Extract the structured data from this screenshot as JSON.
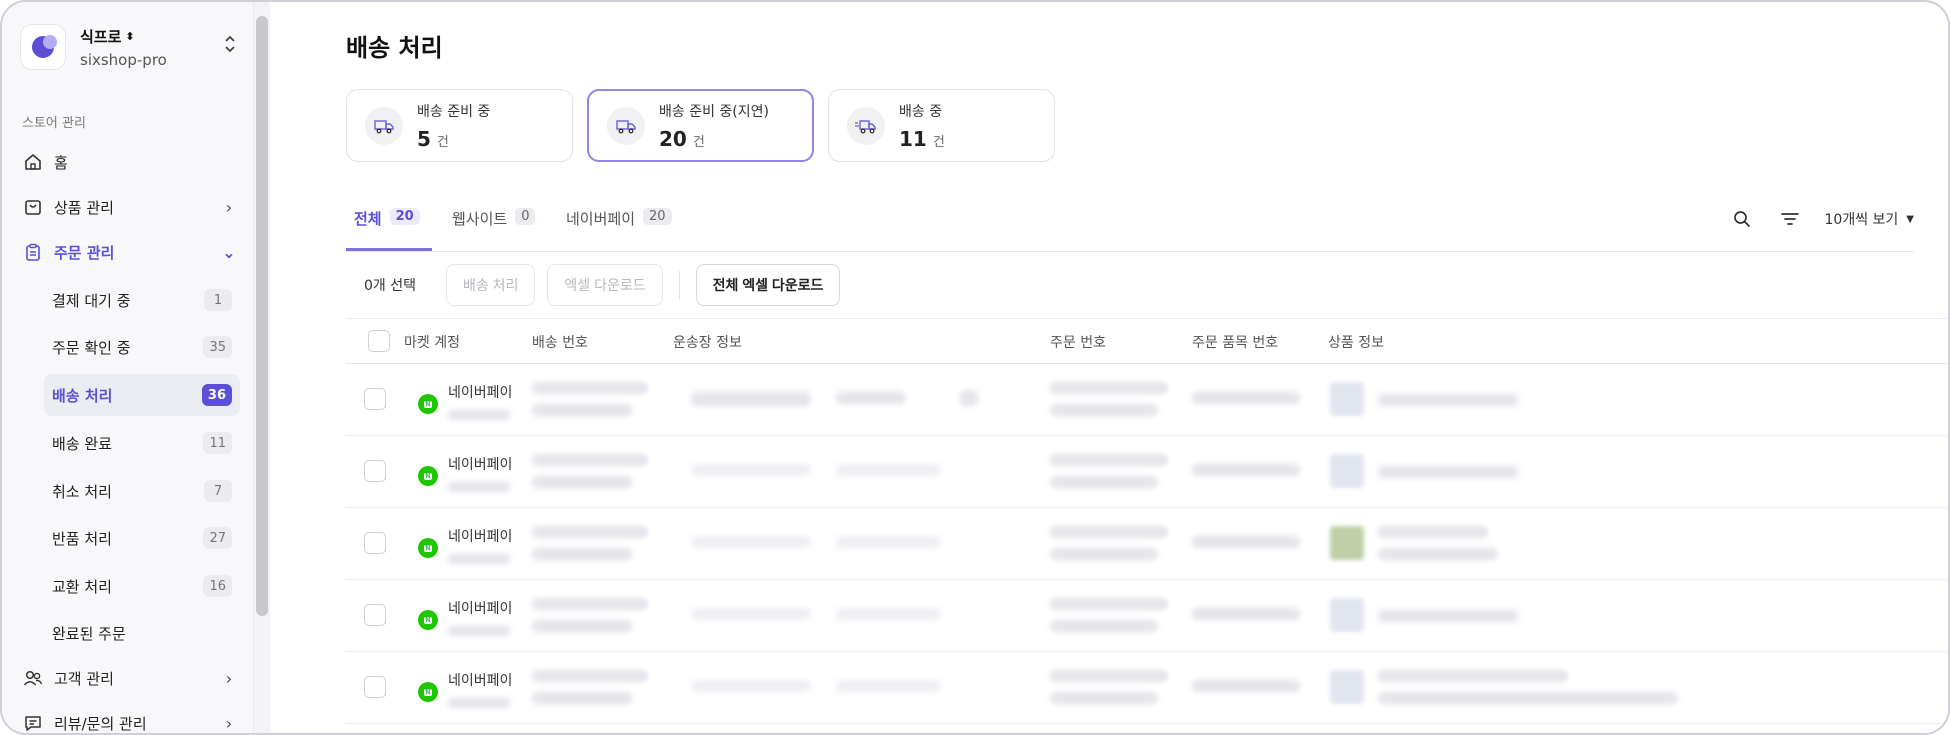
{
  "sidebar": {
    "store_name": "식프로",
    "store_sub": "sixshop-pro",
    "section_label": "스토어 관리",
    "nav": [
      {
        "label": "홈",
        "icon": "home-icon"
      },
      {
        "label": "상품 관리",
        "icon": "shopping-bag-icon"
      },
      {
        "label": "주문 관리",
        "icon": "clipboard-icon"
      }
    ],
    "order_sub": [
      {
        "label": "결제 대기 중",
        "count": "1"
      },
      {
        "label": "주문 확인 중",
        "count": "35"
      },
      {
        "label": "배송 처리",
        "count": "36"
      },
      {
        "label": "배송 완료",
        "count": "11"
      },
      {
        "label": "취소 처리",
        "count": "7"
      },
      {
        "label": "반품 처리",
        "count": "27"
      },
      {
        "label": "교환 처리",
        "count": "16"
      },
      {
        "label": "완료된 주문",
        "count": ""
      }
    ],
    "nav_bottom": [
      {
        "label": "고객 관리",
        "icon": "users-icon"
      },
      {
        "label": "리뷰/문의 관리",
        "icon": "chat-icon"
      }
    ]
  },
  "page": {
    "title": "배송 처리",
    "stats": [
      {
        "label": "배송 준비 중",
        "value": "5",
        "unit": "건"
      },
      {
        "label": "배송 준비 중(지연)",
        "value": "20",
        "unit": "건"
      },
      {
        "label": "배송 중",
        "value": "11",
        "unit": "건"
      }
    ],
    "tabs": [
      {
        "label": "전체",
        "count": "20"
      },
      {
        "label": "웹사이트",
        "count": "0"
      },
      {
        "label": "네이버페이",
        "count": "20"
      }
    ],
    "per_page": "10개씩 보기",
    "selected_text": "0개 선택",
    "actions": {
      "ship": "배송 처리",
      "excel": "엑셀 다운로드",
      "excel_all": "전체 엑셀 다운로드"
    },
    "columns": [
      "마켓 계정",
      "배송 번호",
      "운송장 정보",
      "주문 번호",
      "주문 품목 번호",
      "상품 정보"
    ],
    "rows": [
      {
        "market": "네이버페이"
      },
      {
        "market": "네이버페이"
      },
      {
        "market": "네이버페이"
      },
      {
        "market": "네이버페이"
      },
      {
        "market": "네이버페이"
      }
    ]
  },
  "colors": {
    "accent": "#5b4fd6",
    "naver_green": "#1ec800"
  }
}
